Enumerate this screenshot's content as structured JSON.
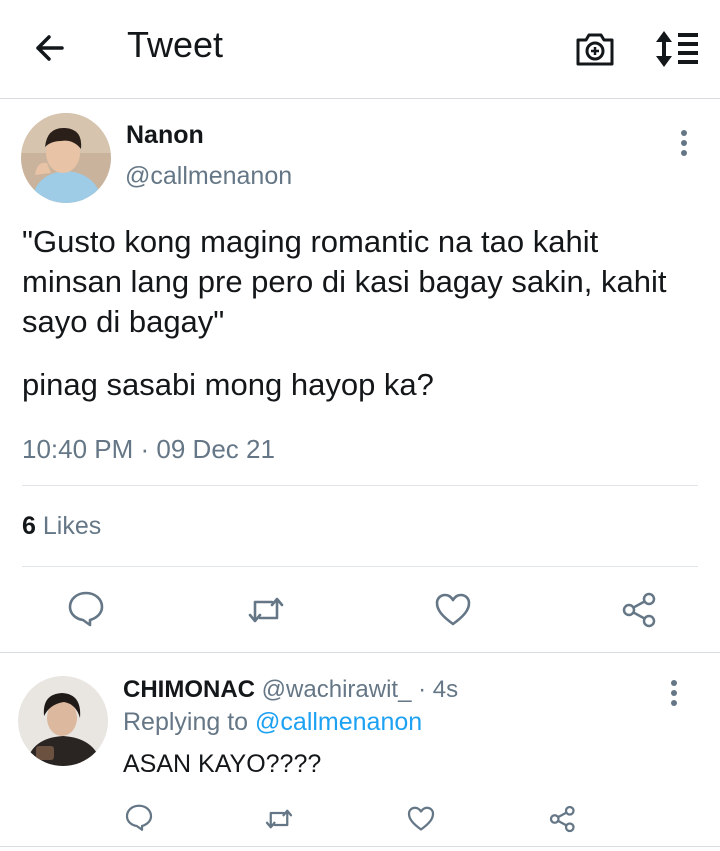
{
  "header": {
    "title": "Tweet",
    "back_icon": "arrow-left-icon",
    "camera_icon": "camera-icon",
    "sort_icon": "sort-icon"
  },
  "tweet": {
    "display_name": "Nanon",
    "handle": "@callmenanon",
    "body_line1": "\"Gusto kong maging romantic na tao kahit minsan lang pre pero di kasi bagay sakin, kahit sayo di bagay\"",
    "body_line2": "pinag sasabi mong hayop ka?",
    "timestamp": "10:40 PM · 09 Dec 21",
    "likes_count": "6",
    "likes_label": "Likes"
  },
  "reply": {
    "display_name": "CHIMONAC",
    "handle": "@wachirawit_",
    "time": "· 4s",
    "replying_label": "Replying to",
    "replying_handle": "@callmenanon",
    "text": "ASAN KAYO????"
  },
  "colors": {
    "text": "#14171a",
    "secondary": "#657786",
    "accent": "#1da1f2",
    "divider": "#e1e6ea"
  }
}
